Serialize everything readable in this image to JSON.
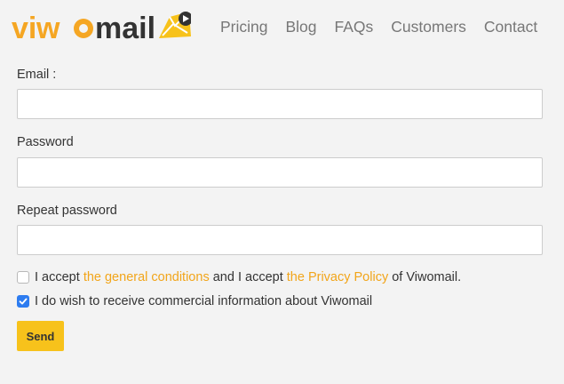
{
  "logo": {
    "text": "viwomail"
  },
  "nav": [
    "Pricing",
    "Blog",
    "FAQs",
    "Customers",
    "Contact"
  ],
  "form": {
    "email_label": "Email :",
    "email_value": "",
    "password_label": "Password",
    "password_value": "",
    "repeat_label": "Repeat password",
    "repeat_value": "",
    "terms": {
      "checked": false,
      "prefix": "I accept ",
      "link1": "the general conditions",
      "middle": " and I accept ",
      "link2": "the Privacy Policy",
      "suffix": " of Viwomail."
    },
    "commercial": {
      "checked": true,
      "text": "I do wish to receive commercial information about Viwomail"
    },
    "send_label": "Send"
  },
  "colors": {
    "accent": "#f7c21b",
    "link": "#f2a51a",
    "logo_orange": "#f39c12",
    "logo_text": "#333333",
    "checkbox": "#2d7cf0"
  }
}
